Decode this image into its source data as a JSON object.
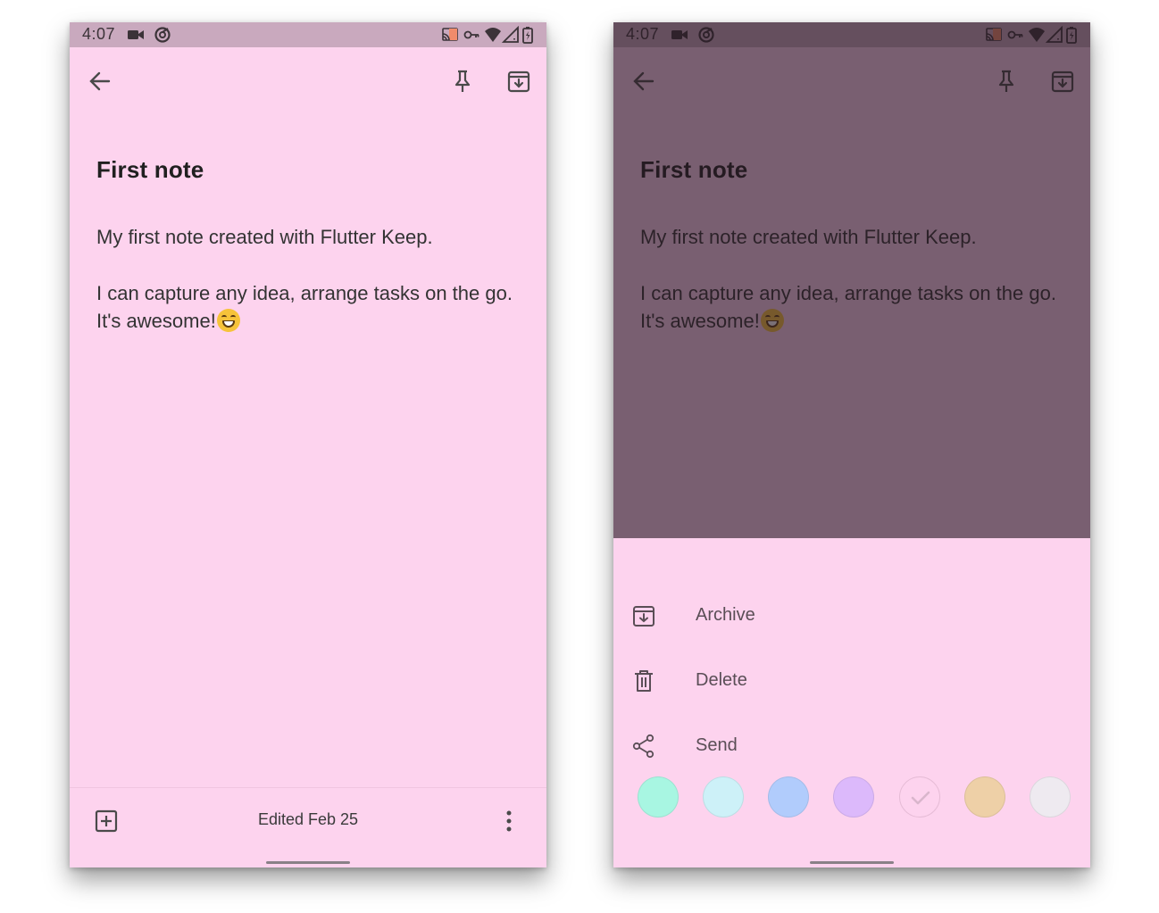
{
  "status": {
    "time": "4:07"
  },
  "note": {
    "title": "First note",
    "paragraph_1": "My first note created with Flutter Keep.",
    "paragraph_2": "I can capture any idea, arrange tasks on the go. It's awesome!",
    "edited": "Edited Feb 25"
  },
  "menu": {
    "items": [
      {
        "label": "Archive",
        "icon": "archive-icon"
      },
      {
        "label": "Delete",
        "icon": "trash-icon"
      },
      {
        "label": "Send",
        "icon": "share-icon"
      }
    ]
  },
  "colors": {
    "note_background": "#fdd3ee",
    "status_bar": "#c9a9be",
    "scrim": "rgba(40,24,36,0.62)",
    "swatches": [
      "#a8f6e2",
      "#cdf1f8",
      "#b1ccfc",
      "#dcb9fb",
      "#fdd3ee",
      "#eed0a7",
      "#eeeaf0"
    ],
    "selected_swatch": "#fdd3ee"
  }
}
